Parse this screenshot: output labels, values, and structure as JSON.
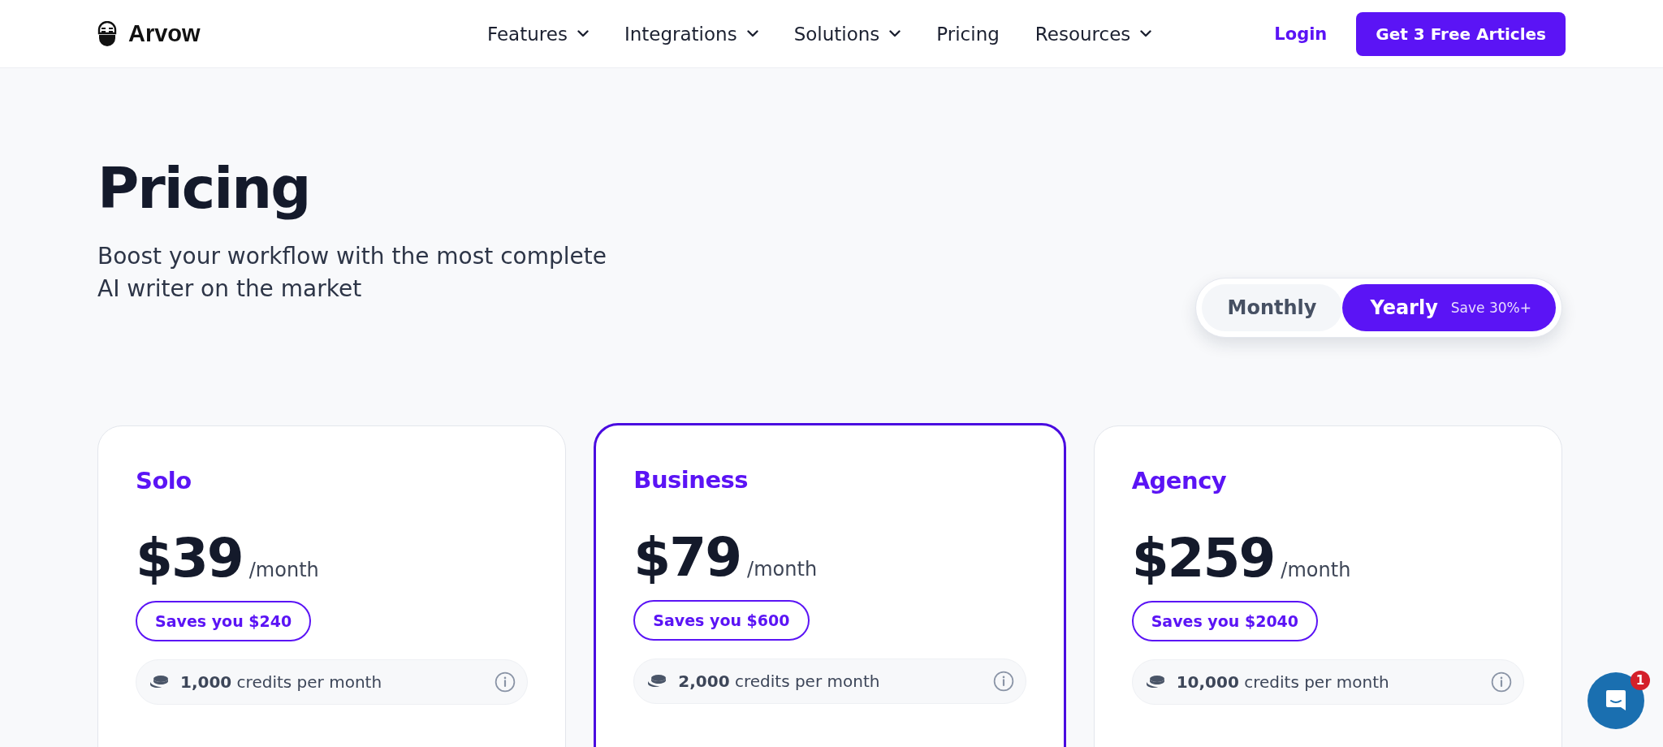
{
  "header": {
    "brand": "Arvow",
    "nav": [
      {
        "label": "Features",
        "dropdown": true
      },
      {
        "label": "Integrations",
        "dropdown": true
      },
      {
        "label": "Solutions",
        "dropdown": true
      },
      {
        "label": "Pricing",
        "dropdown": false
      },
      {
        "label": "Resources",
        "dropdown": true
      }
    ],
    "login": "Login",
    "cta": "Get 3 Free Articles"
  },
  "hero": {
    "title": "Pricing",
    "subtitle": [
      "Boost your workflow with the most complete",
      "AI writer on the market"
    ]
  },
  "billing_toggle": [
    {
      "label": "Monthly",
      "selected": false
    },
    {
      "label": "Yearly",
      "note": "Save 30%+",
      "selected": true
    }
  ],
  "plans": [
    {
      "name": "Solo",
      "price": "$39",
      "period": "/month",
      "savings": "Saves you $240",
      "credits": "**1,000** credits per month",
      "highlighted": false
    },
    {
      "name": "Business",
      "price": "$79",
      "period": "/month",
      "savings": "Saves you $600",
      "credits": "**2,000** credits per month",
      "highlighted": true
    },
    {
      "name": "Agency",
      "price": "$259",
      "period": "/month",
      "savings": "Saves you $2040",
      "credits": "**10,000** credits per month",
      "highlighted": false
    }
  ],
  "chat": {
    "badge": "1"
  }
}
